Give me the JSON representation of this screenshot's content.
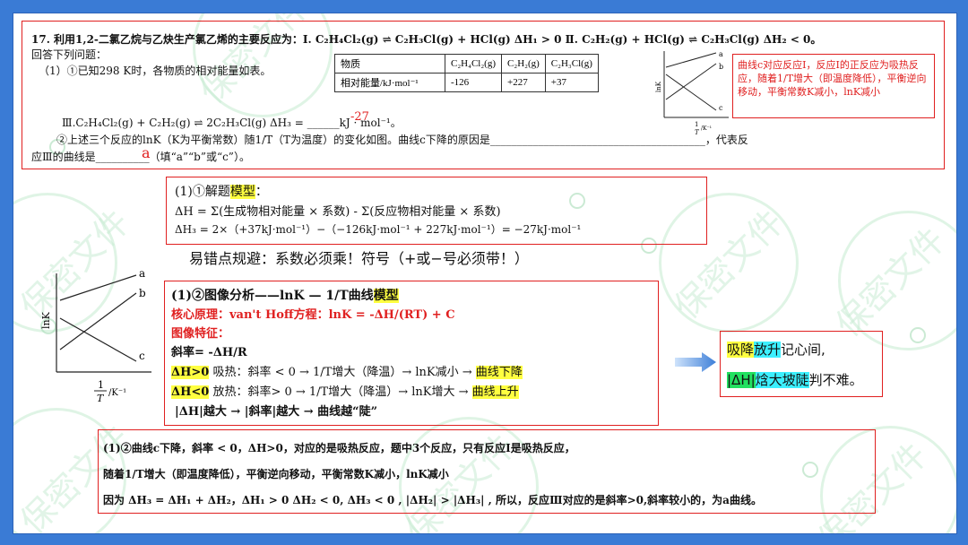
{
  "watermark": "保密文件",
  "question": {
    "line1": "17. 利用1,2-二氯乙烷与乙炔生产氯乙烯的主要反应为：Ⅰ. C₂H₄Cl₂(g) ⇌ C₂H₃Cl(g) + HCl(g)  ΔH₁ > 0   Ⅱ. C₂H₂(g) + HCl(g) ⇌ C₂H₃Cl(g)  ΔH₂ < 0。",
    "line2": "回答下列问题：",
    "line3": "（1）①已知298 K时，各物质的相对能量如表。",
    "table": {
      "headers": [
        "物质",
        "C₂H₄Cl₂(g)",
        "C₂H₂(g)",
        "C₂H₃Cl(g)"
      ],
      "row": [
        "相对能量/kJ·mol⁻¹",
        "-126",
        "+227",
        "+37"
      ]
    },
    "reaction3": "Ⅲ.C₂H₄Cl₂(g) + C₂H₂(g) ⇌ 2C₂H₃Cl(g)  ΔH₃ = ______kJ · mol⁻¹。",
    "answer_dh3": "-27",
    "line5": "②上述三个反应的lnK（K为平衡常数）随1/T（T为温度）的变化如图。曲线c下降的原因是________________________________________，代表反",
    "line6": "应Ⅲ的曲线是__________（填“a”“b”或“c”）。",
    "answer_curve": "a",
    "red_note": "曲线c对应反应Ⅰ，反应Ⅰ的正反应为吸热反应，随着1/T增大（即温度降低），平衡逆向移动，平衡常数K减小，lnK减小"
  },
  "graph_labels": {
    "a": "a",
    "b": "b",
    "c": "c",
    "ylabel": "lnK",
    "xlabel_num": "1",
    "xlabel_den": "T",
    "xlabel_unit": "/K⁻¹"
  },
  "box1": {
    "title_pre": "(1)①解题",
    "title_hl": "模型",
    "title_post": "：",
    "formula": "ΔH = Σ(生成物相对能量 × 系数) - Σ(反应物相对能量 × 系数)",
    "calc": "ΔH₃ = 2×（+37kJ·mol⁻¹）−（−126kJ·mol⁻¹ + 227kJ·mol⁻¹）= −27kJ·mol⁻¹"
  },
  "tip": "易错点规避：系数必须乘！符号（+或−号必须带！）",
  "box2": {
    "title_pre": "(1)②图像分析——lnK — 1/T曲线",
    "title_hl": "模型",
    "principle": "核心原理：van't Hoff方程：lnK = -ΔH/(RT) + C",
    "feature": "图像特征：",
    "slope": "斜率= -ΔH/R",
    "endo_hl": "ΔH>0",
    "endo": " 吸热：斜率 < 0 → 1/T增大（降温）→ lnK减小 → ",
    "endo_result": "曲线下降",
    "exo_hl": "ΔH<0",
    "exo": " 放热：斜率> 0 → 1/T增大（降温）→ lnK增大 → ",
    "exo_result": "曲线上升",
    "steep": "|ΔH|越大 → |斜率|越大 → 曲线越“陡”"
  },
  "mnemonic": {
    "l1_a": "吸降",
    "l1_b": "放升",
    "l1_c": "记心间,",
    "l2_a": "|ΔH|",
    "l2_b": "焓大坡陡",
    "l2_c": "判不难。"
  },
  "box3": {
    "l1": "(1)②曲线c下降，斜率 < 0，ΔH>0，对应的是吸热反应，题中3个反应，只有反应Ⅰ是吸热反应，",
    "l2": "随着1/T增大（即温度降低），平衡逆向移动，平衡常数K减小，lnK减小",
    "l3": "因为 ΔH₃ = ΔH₁ + ΔH₂，ΔH₁ > 0   ΔH₂ < 0, ΔH₃ < 0 , |ΔH₂| > |ΔH₃| , 所以，反应Ⅲ对应的是斜率>0,斜率较小的，为a曲线。"
  }
}
